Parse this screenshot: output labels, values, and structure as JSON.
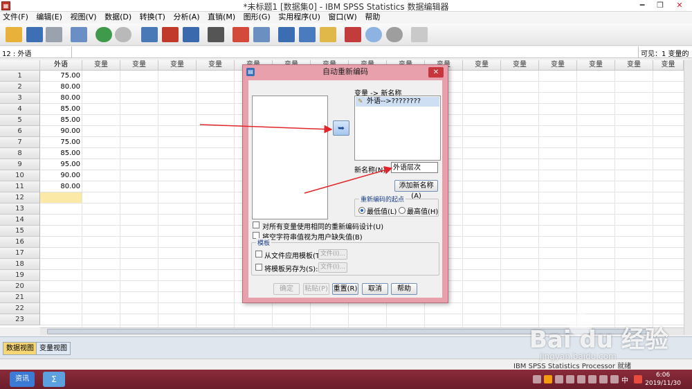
{
  "window": {
    "title": "*未标题1 [数据集0] - IBM SPSS Statistics 数据编辑器",
    "min": "━",
    "max": "❐",
    "close": "✕",
    "icon": "spss-app-icon"
  },
  "menu": [
    "文件(F)",
    "编辑(E)",
    "视图(V)",
    "数据(D)",
    "转换(T)",
    "分析(A)",
    "直销(M)",
    "图形(G)",
    "实用程序(U)",
    "窗口(W)",
    "帮助"
  ],
  "cellbar": {
    "ref": "12 : 外语",
    "visible": "可见：1 变量的 1"
  },
  "grid": {
    "first_column": "外语",
    "empty_column": "变量",
    "values": [
      "75.00",
      "80.00",
      "80.00",
      "85.00",
      "85.00",
      "90.00",
      "75.00",
      "85.00",
      "95.00",
      "90.00",
      "80.00"
    ],
    "row_numbers": [
      "1",
      "2",
      "3",
      "4",
      "5",
      "6",
      "7",
      "8",
      "9",
      "10",
      "11",
      "12",
      "13",
      "14",
      "15",
      "16",
      "17",
      "18",
      "19",
      "20",
      "21",
      "22",
      "23"
    ]
  },
  "dialog": {
    "title": "自动重新编码",
    "close": "✕",
    "variable_header": "变量 -> 新名称",
    "variable_item": "外语-->????????",
    "new_name_label": "新名称(N):",
    "new_name_value": "外语层次",
    "add_name_button": "添加新名称(A)",
    "recode_start_group": "重新编码的起点",
    "radio_lowest": "最低值(L)",
    "radio_highest": "最高值(H)",
    "check_same_scheme": "对所有变量使用相同的重新编码设计(U)",
    "check_blank_missing": "将空字符串值视为用户缺失值(B)",
    "template_group": "模板",
    "check_apply_template": "从文件应用模板(T):",
    "check_save_template": "将模板另存为(S):",
    "file_button": "文件(I)...",
    "buttons": {
      "ok": "确定",
      "paste": "粘贴(P)",
      "reset": "重置(R)",
      "cancel": "取消",
      "help": "帮助"
    }
  },
  "tabs": {
    "data_view": "数据视图",
    "variable_view": "变量视图"
  },
  "status": {
    "text": "IBM SPSS Statistics Processor 就绪"
  },
  "taskbar": {
    "app1": "资讯",
    "app2": "Σ",
    "time": "6:06",
    "date": "2019/11/30",
    "ime": "中"
  },
  "watermark": {
    "brand": "Bai du 经验",
    "url": "jingyan.baidu.com"
  },
  "colors": {
    "dialog_border": "#e8a0ad",
    "selection": "#cfdff3",
    "arrow": "#e0262a",
    "taskbar": "#7a2433",
    "active_tab": "#f7d774"
  }
}
